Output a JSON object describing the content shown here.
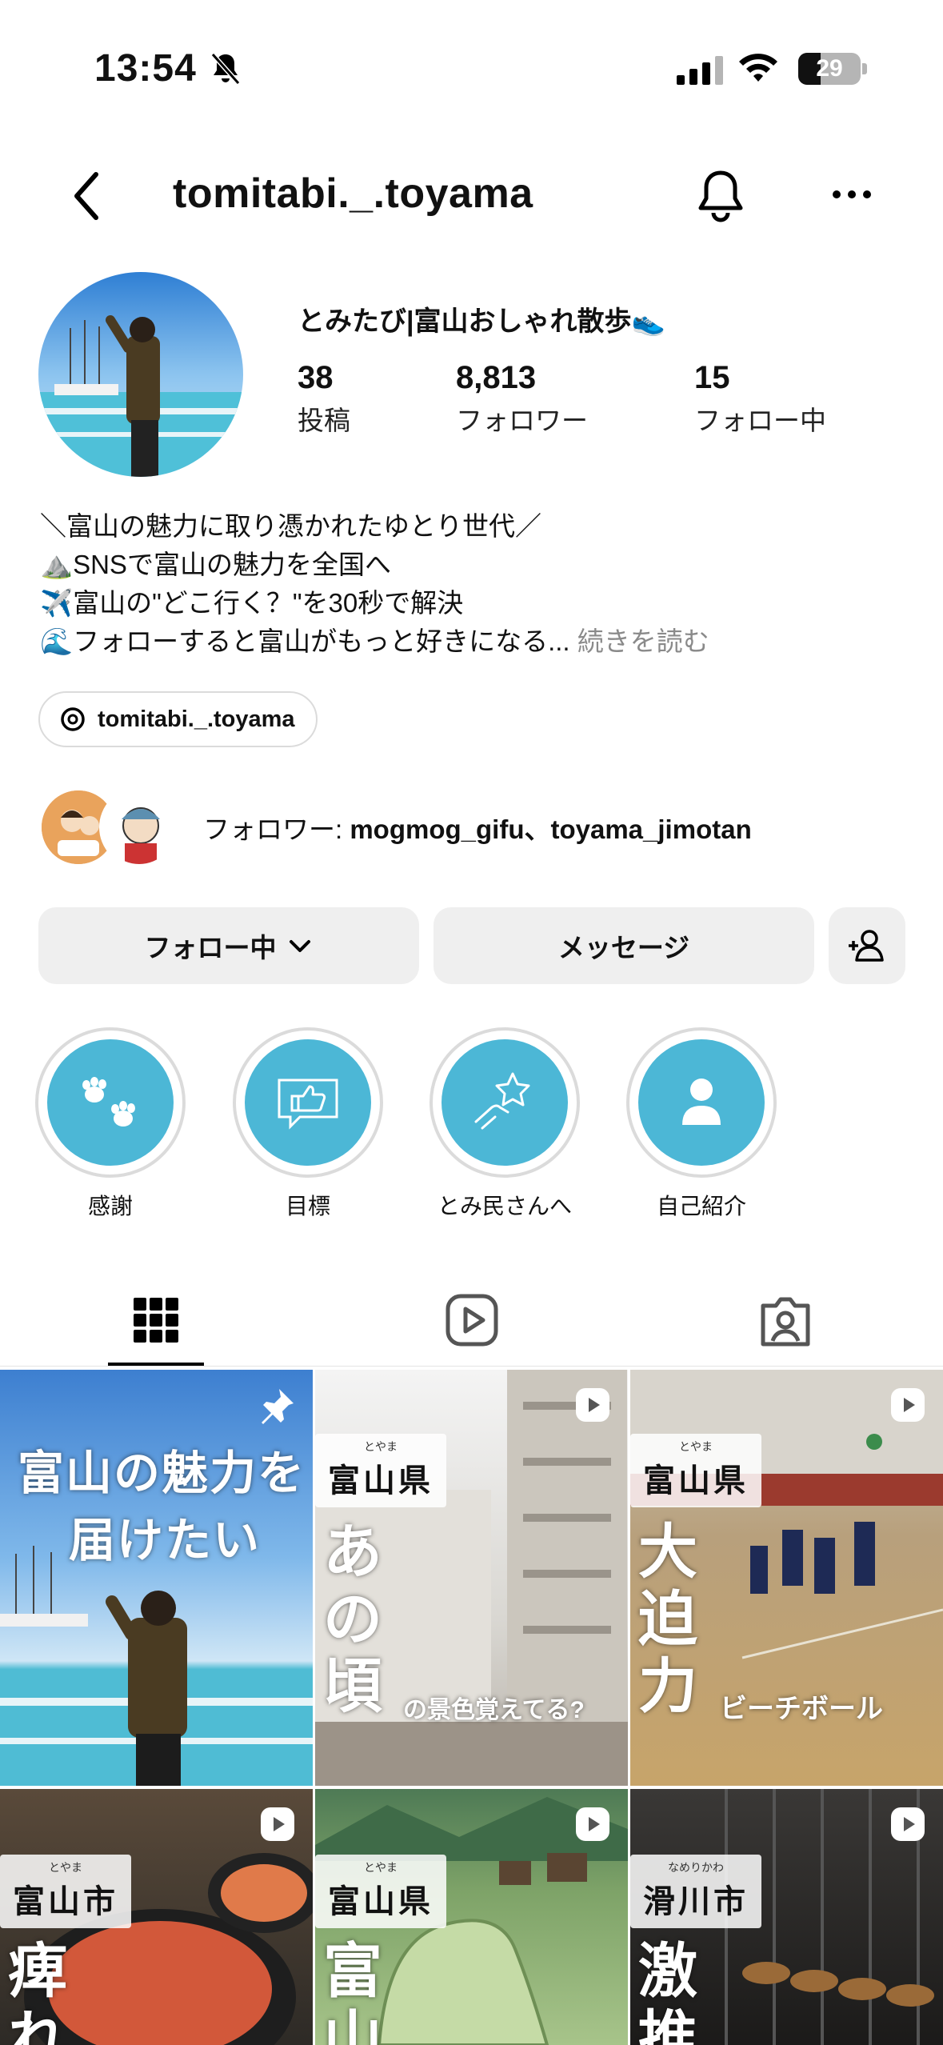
{
  "status_bar": {
    "time": "13:54",
    "battery": "29"
  },
  "header": {
    "username": "tomitabi._.toyama"
  },
  "profile": {
    "display_name": "とみたび|富山おしゃれ散歩👟",
    "stats": [
      {
        "value": "38",
        "label": "投稿"
      },
      {
        "value": "8,813",
        "label": "フォロワー"
      },
      {
        "value": "15",
        "label": "フォロー中"
      }
    ],
    "bio": [
      "＼富山の魅力に取り憑かれたゆとり世代／",
      "⛰️SNSで富山の魅力を全国へ",
      "✈️富山の\"どこ行く？\"を30秒で解決",
      "🌊フォローすると富山がもっと好きになる..."
    ],
    "bio_more": "続きを読む",
    "threads_handle": "tomitabi._.toyama",
    "followers_prefix": "フォロワー: ",
    "followers_names": "mogmog_gifu、toyama_jimotan"
  },
  "actions": {
    "following": "フォロー中",
    "message": "メッセージ"
  },
  "highlights": [
    {
      "label": "感謝",
      "icon": "paw-icon"
    },
    {
      "label": "目標",
      "icon": "thumbs-up-icon"
    },
    {
      "label": "とみ民さんへ",
      "icon": "star-hand-icon"
    },
    {
      "label": "自己紹介",
      "icon": "person-icon"
    }
  ],
  "tabs": [
    "grid-icon",
    "reels-icon",
    "tagged-icon"
  ],
  "posts": [
    {
      "line1": "富山の魅力を",
      "line2": "届けたい",
      "pinned": true
    },
    {
      "ruby": "とやま",
      "badge": "富山県",
      "big": "あの頃",
      "caption": "の景色覚えてる?"
    },
    {
      "ruby": "とやま",
      "badge": "富山県",
      "big": "大迫力",
      "caption": "ビーチボール"
    },
    {
      "ruby": "とやま",
      "badge": "富山市",
      "big": "痺れ"
    },
    {
      "ruby": "とやま",
      "badge": "富山県",
      "big": "富山"
    },
    {
      "ruby": "なめりかわ",
      "badge": "滑川市",
      "big": "激推"
    }
  ],
  "colors": {
    "highlight": "#4cb7d6",
    "button_bg": "#efefef",
    "muted_text": "#8a8a8a"
  }
}
